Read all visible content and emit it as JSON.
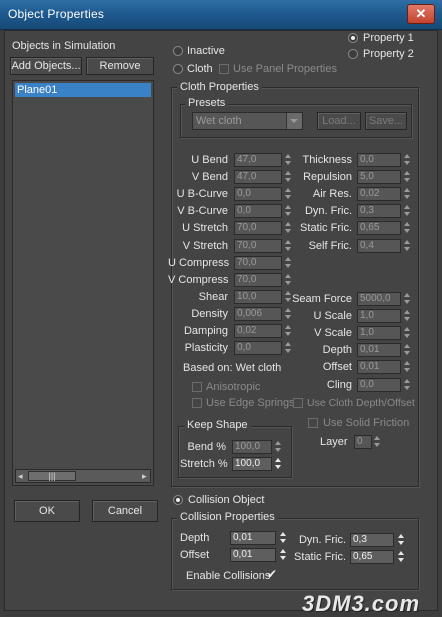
{
  "window": {
    "title": "Object Properties"
  },
  "sim": {
    "heading": "Objects in Simulation",
    "add_label": "Add Objects...",
    "remove_label": "Remove",
    "items": [
      "Plane01"
    ]
  },
  "footer": {
    "ok_label": "OK",
    "cancel_label": "Cancel"
  },
  "mode": {
    "inactive_label": "Inactive",
    "cloth_label": "Cloth",
    "use_panel_label": "Use Panel Properties",
    "property1_label": "Property 1",
    "property2_label": "Property 2",
    "collision_label": "Collision Object"
  },
  "cloth": {
    "group_title": "Cloth Properties",
    "presets_title": "Presets",
    "preset_value": "Wet cloth",
    "load_label": "Load...",
    "save_label": "Save...",
    "left_fields": [
      {
        "label": "U Bend",
        "value": "47,0"
      },
      {
        "label": "V Bend",
        "value": "47,0"
      },
      {
        "label": "U B-Curve",
        "value": "0,0"
      },
      {
        "label": "V B-Curve",
        "value": "0,0"
      },
      {
        "label": "U Stretch",
        "value": "70,0"
      },
      {
        "label": "V Stretch",
        "value": "70,0"
      },
      {
        "label": "U Compress",
        "value": "70,0"
      },
      {
        "label": "V Compress",
        "value": "70,0"
      },
      {
        "label": "Shear",
        "value": "10,0"
      },
      {
        "label": "Density",
        "value": "0,006"
      },
      {
        "label": "Damping",
        "value": "0,02"
      },
      {
        "label": "Plasticity",
        "value": "0,0"
      }
    ],
    "right_fields_top": [
      {
        "label": "Thickness",
        "value": "0,0"
      },
      {
        "label": "Repulsion",
        "value": "5,0"
      },
      {
        "label": "Air Res.",
        "value": "0,02"
      },
      {
        "label": "Dyn. Fric.",
        "value": "0,3"
      },
      {
        "label": "Static Fric.",
        "value": "0,65"
      },
      {
        "label": "Self Fric.",
        "value": "0,4"
      }
    ],
    "right_fields_bottom": [
      {
        "label": "Seam Force",
        "value": "5000,0"
      },
      {
        "label": "U Scale",
        "value": "1,0"
      },
      {
        "label": "V Scale",
        "value": "1,0"
      },
      {
        "label": "Depth",
        "value": "0,01"
      },
      {
        "label": "Offset",
        "value": "0,01"
      },
      {
        "label": "Cling",
        "value": "0,0"
      }
    ],
    "based_on": "Based on: Wet cloth",
    "anisotropic_label": "Anisotropic",
    "use_edge_springs_label": "Use Edge Springs",
    "use_cloth_depth_label": "Use Cloth Depth/Offset",
    "use_solid_friction_label": "Use Solid Friction",
    "layer_label": "Layer",
    "layer_value": "0"
  },
  "keep_shape": {
    "title": "Keep Shape",
    "bend_label": "Bend %",
    "bend_value": "100,0",
    "stretch_label": "Stretch %",
    "stretch_value": "100,0"
  },
  "collision": {
    "group_title": "Collision Properties",
    "depth_label": "Depth",
    "depth_value": "0,01",
    "offset_label": "Offset",
    "offset_value": "0,01",
    "dyn_fric_label": "Dyn. Fric.",
    "dyn_fric_value": "0,3",
    "static_fric_label": "Static Fric.",
    "static_fric_value": "0,65",
    "enable_label": "Enable Collisions",
    "enable_checked": true
  },
  "watermark": {
    "text": "3DM3.com"
  }
}
